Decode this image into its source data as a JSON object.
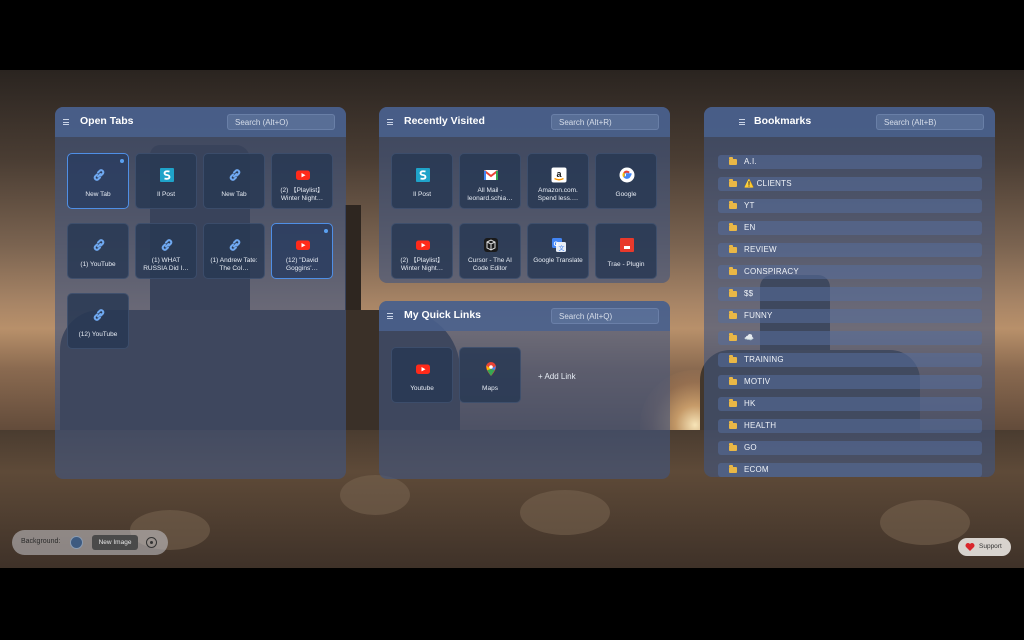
{
  "open_tabs": {
    "title": "Open Tabs",
    "search_placeholder": "Search (Alt+O)",
    "tiles": [
      {
        "label": "New Tab",
        "icon": "link-icon",
        "active": true
      },
      {
        "label": "Il Post",
        "icon": "il-post-icon",
        "active": false
      },
      {
        "label": "New Tab",
        "icon": "link-icon",
        "active": false
      },
      {
        "label": "(2) 【Playlist】 Winter Night…",
        "icon": "youtube-icon",
        "active": false
      },
      {
        "label": "(1) YouTube",
        "icon": "link-icon",
        "active": false
      },
      {
        "label": "(1) WHAT RUSSIA Did I…",
        "icon": "link-icon",
        "active": false
      },
      {
        "label": "(1) Andrew Tate: The Col…",
        "icon": "link-icon",
        "active": false
      },
      {
        "label": "(12) \"David Goggins'…",
        "icon": "youtube-icon",
        "active": true
      },
      {
        "label": "(12) YouTube",
        "icon": "link-icon",
        "active": false
      }
    ]
  },
  "recently_visited": {
    "title": "Recently Visited",
    "search_placeholder": "Search (Alt+R)",
    "tiles": [
      {
        "label": "Il Post",
        "icon": "il-post-icon"
      },
      {
        "label": "All Mail - leonard.schia…",
        "icon": "gmail-icon"
      },
      {
        "label": "Amazon.com. Spend less.…",
        "icon": "amazon-icon"
      },
      {
        "label": "Google",
        "icon": "google-icon"
      },
      {
        "label": "(2) 【Playlist】 Winter Night…",
        "icon": "youtube-icon"
      },
      {
        "label": "Cursor - The AI Code Editor",
        "icon": "cursor-icon"
      },
      {
        "label": "Google Translate",
        "icon": "google-translate-icon"
      },
      {
        "label": "Trae - Plugin",
        "icon": "trae-icon"
      }
    ]
  },
  "quick_links": {
    "title": "My Quick Links",
    "search_placeholder": "Search (Alt+Q)",
    "tiles": [
      {
        "label": "Youtube",
        "icon": "youtube-icon"
      },
      {
        "label": "Maps",
        "icon": "maps-icon"
      }
    ],
    "add_label": "+ Add Link"
  },
  "bookmarks": {
    "title": "Bookmarks",
    "search_placeholder": "Search (Alt+B)",
    "items": [
      "A.I.",
      "⚠️ CLIENTS",
      "YT",
      "EN",
      "REVIEW",
      "CONSPIRACY",
      "$$",
      "FUNNY",
      "☁️",
      "TRAINING",
      "MOTIV",
      "HK",
      "HEALTH",
      "GO",
      "ECOM"
    ]
  },
  "background_control": {
    "label": "Background:",
    "new_image_label": "New Image"
  },
  "support": {
    "label": "Support"
  },
  "colors": {
    "accent": "#4f8fe6",
    "panel": "#405680",
    "folder": "#e9b746"
  }
}
